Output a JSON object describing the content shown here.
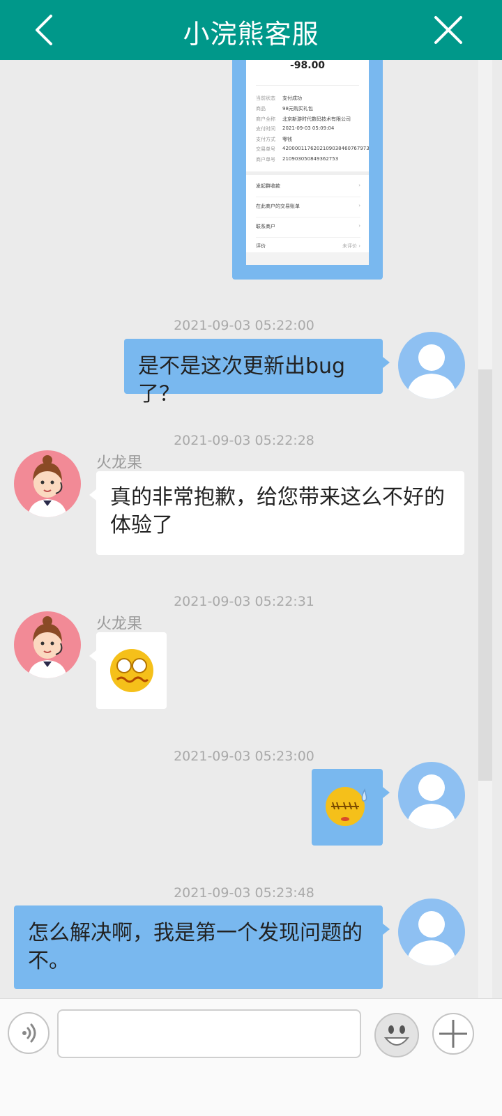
{
  "header": {
    "title": "小浣熊客服",
    "back_icon": "chevron-left-icon",
    "close_icon": "close-icon",
    "bg_color": "#00988a"
  },
  "receipt": {
    "amount": "-98.00",
    "rows": [
      {
        "label": "当前状态",
        "value": "支付成功"
      },
      {
        "label": "商品",
        "value": "98元购买礼包"
      },
      {
        "label": "商户全称",
        "value": "北京新游时代数码技术有限公司"
      },
      {
        "label": "支付时间",
        "value": "2021-09-03  05:09:04"
      },
      {
        "label": "支付方式",
        "value": "零钱"
      },
      {
        "label": "交易单号",
        "value": "4200001176202109038460767973"
      },
      {
        "label": "商户单号",
        "value": "210903050849362753"
      }
    ],
    "links": [
      {
        "label": "发起群收款"
      },
      {
        "label": "在此商户的交易账单"
      },
      {
        "label": "联系商户"
      },
      {
        "label": "评价",
        "value": "未评价"
      }
    ]
  },
  "messages": [
    {
      "timestamp": "2021-09-03  05:22:00",
      "from": "me",
      "text": "是不是这次更新出bug了？"
    },
    {
      "timestamp": "2021-09-03  05:22:28",
      "from": "agent",
      "sender": "火龙果",
      "text": "真的非常抱歉，给您带来这么不好的体验了"
    },
    {
      "timestamp": "2021-09-03  05:22:31",
      "from": "agent",
      "sender": "火龙果",
      "sticker": "worried-face-sticker"
    },
    {
      "timestamp": "2021-09-03  05:23:00",
      "from": "me",
      "sticker": "awkward-sweat-face-sticker"
    },
    {
      "timestamp": "2021-09-03  05:23:48",
      "from": "me",
      "text": "怎么解决啊，我是第一个发现问题的不。"
    }
  ],
  "input": {
    "value": "",
    "placeholder": ""
  },
  "icons": {
    "voice": "voice-icon",
    "emoji": "emoji-icon",
    "plus": "plus-icon"
  },
  "colors": {
    "my_bubble": "#79b8ef",
    "agent_bubble": "#ffffff",
    "background": "#ebebeb"
  }
}
